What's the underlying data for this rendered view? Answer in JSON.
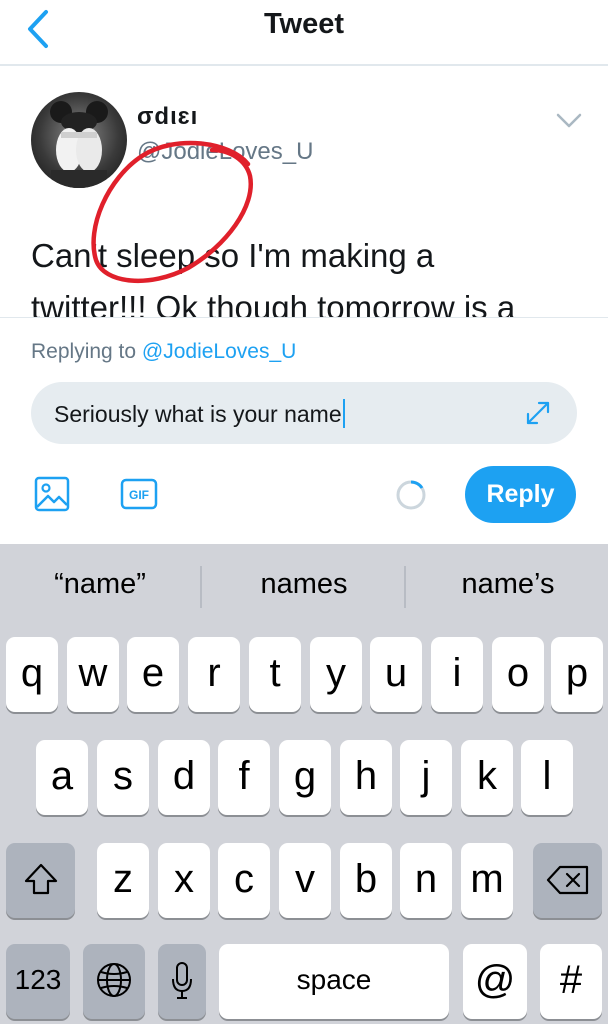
{
  "header": {
    "title": "Tweet",
    "back_icon": "chevron-left-icon"
  },
  "tweet": {
    "display_name": "σdιɛı",
    "handle": "@JodieLoves_U",
    "text_line1": "Can't sleep so I'm making a",
    "text_line2": "twitter!!! Ok though tomorrow is a"
  },
  "composer": {
    "replying_prefix": "Replying to ",
    "replying_handle": "@JodieLoves_U",
    "input_value": "Seriously what is your name",
    "reply_label": "Reply",
    "gif_label": "GIF"
  },
  "keyboard": {
    "suggestions": [
      "“name”",
      "names",
      "name’s"
    ],
    "row1": [
      "q",
      "w",
      "e",
      "r",
      "t",
      "y",
      "u",
      "i",
      "o",
      "p"
    ],
    "row2": [
      "a",
      "s",
      "d",
      "f",
      "g",
      "h",
      "j",
      "k",
      "l"
    ],
    "row3": [
      "z",
      "x",
      "c",
      "v",
      "b",
      "n",
      "m"
    ],
    "numbers_label": "123",
    "space_label": "space",
    "at_label": "@",
    "hash_label": "#"
  },
  "colors": {
    "accent": "#1da1f2",
    "annotation": "#e0202b",
    "keyboard_bg": "#d1d3d9"
  }
}
